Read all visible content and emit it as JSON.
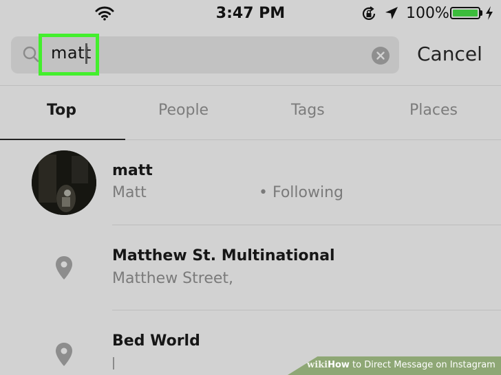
{
  "status_bar": {
    "time": "3:47 PM",
    "battery_percent": "100%",
    "icons": [
      "wifi-icon",
      "rotation-lock-icon",
      "location-arrow-icon",
      "battery-icon",
      "charging-bolt-icon"
    ]
  },
  "search": {
    "value": "matt",
    "cancel_label": "Cancel"
  },
  "tabs": [
    {
      "label": "Top",
      "active": true
    },
    {
      "label": "People",
      "active": false
    },
    {
      "label": "Tags",
      "active": false
    },
    {
      "label": "Places",
      "active": false
    }
  ],
  "results": [
    {
      "title": "matt",
      "subtitle": "Matt",
      "status": "• Following",
      "icon": "avatar"
    },
    {
      "title": "Matthew St. Multinational",
      "subtitle": "Matthew Street,",
      "icon": "map-pin-icon"
    },
    {
      "title": "Bed World",
      "subtitle": "",
      "icon": "map-pin-icon"
    }
  ],
  "colors": {
    "highlight": "#43ef2d",
    "battery": "#3cbc3c",
    "background": "#d2d2d2"
  },
  "watermark": {
    "wiki": "wiki",
    "how": "How",
    "rest": " to Direct Message on Instagram"
  }
}
